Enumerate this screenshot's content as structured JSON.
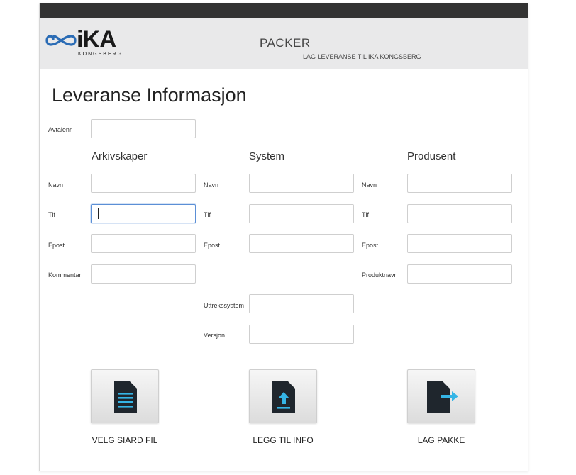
{
  "header": {
    "logo_text": "iKA",
    "logo_subtext": "KONGSBERG",
    "app_title": "PACKER",
    "app_subtitle": "LAG LEVERANSE TIL IKA KONGSBERG"
  },
  "page_title": "Leveranse Informasjon",
  "agreement": {
    "label": "Avtalenr",
    "value": ""
  },
  "sections": {
    "archive_creator": {
      "heading": "Arkivskaper",
      "name_label": "Navn",
      "phone_label": "Tlf",
      "email_label": "Epost",
      "comment_label": "Kommentar"
    },
    "system": {
      "heading": "System",
      "name_label": "Navn",
      "phone_label": "Tlf",
      "email_label": "Epost",
      "extraction_label": "Uttrekssystem",
      "version_label": "Versjon"
    },
    "producer": {
      "heading": "Produsent",
      "name_label": "Navn",
      "phone_label": "Tlf",
      "email_label": "Epost",
      "product_label": "Produktnavn"
    }
  },
  "actions": {
    "select_siard": "VELG SIARD FIL",
    "add_info": "LEGG TIL INFO",
    "create_package": "LAG PAKKE"
  },
  "colors": {
    "titlebar": "#333333",
    "header_bg": "#e9e9ea",
    "logo_blue": "#2b6cb5",
    "icon_dark": "#1f262d",
    "icon_cyan": "#35b5e6",
    "focus_border": "#5b8fd6"
  },
  "icons": {
    "select_siard": "document-lines-icon",
    "add_info": "document-upload-icon",
    "create_package": "document-arrow-icon"
  }
}
